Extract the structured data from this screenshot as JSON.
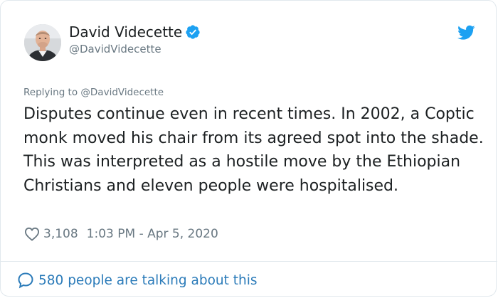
{
  "author": {
    "name": "David Videcette",
    "handle": "@DavidVidecette"
  },
  "reply": {
    "prefix": "Replying to ",
    "handle": "@DavidVidecette"
  },
  "tweet": {
    "text": "Disputes continue even in recent times. In 2002, a Coptic monk moved his chair from its agreed spot into the shade. This was interpreted as a hostile move by the Ethiopian Christians and eleven people were hospitalised."
  },
  "meta": {
    "likes": "3,108",
    "timestamp": "1:03 PM - Apr 5, 2020"
  },
  "footer": {
    "talking": "580 people are talking about this"
  },
  "colors": {
    "text": "#1c2022",
    "secondary": "#697882",
    "link": "#2b7bb9",
    "twitter_blue": "#1da1f2",
    "border": "#e1e8ed"
  },
  "icons": [
    "avatar-photo",
    "verified-badge-icon",
    "twitter-bird-icon",
    "heart-icon",
    "speech-bubble-icon"
  ]
}
